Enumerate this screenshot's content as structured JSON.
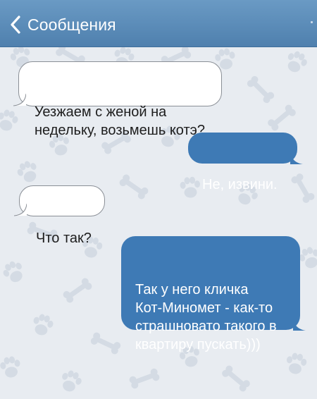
{
  "header": {
    "back_label": "Сообщения",
    "back_icon": "chevron-left-icon",
    "background": "#5a8bb8",
    "text_color": "#ffffff"
  },
  "chat": {
    "background": "#e8ecf1",
    "wallpaper_icons": [
      "paw-icon",
      "bone-icon"
    ],
    "incoming_bubble_color": "#ffffff",
    "outgoing_bubble_color": "#3e7ab5",
    "messages": [
      {
        "direction": "incoming",
        "text": "Уезжаем с женой на\nнедельку, возьмешь котэ?"
      },
      {
        "direction": "outgoing",
        "text": "Не, извини."
      },
      {
        "direction": "incoming",
        "text": "Что так?"
      },
      {
        "direction": "outgoing",
        "text": "Так у него кличка\nКот-Миномет - как-то\nстрашновато такого в\nквартиру пускать)))"
      }
    ]
  }
}
